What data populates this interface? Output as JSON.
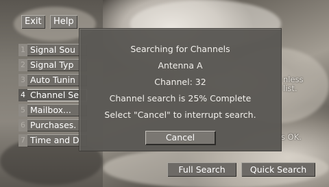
{
  "top_bar": {
    "exit_label": "Exit",
    "help_label": "Help"
  },
  "menu": {
    "items": [
      {
        "num": "1",
        "label": "Signal Sou"
      },
      {
        "num": "2",
        "label": "Signal Typ"
      },
      {
        "num": "3",
        "label": "Auto Tunin"
      },
      {
        "num": "4",
        "label": "Channel Se"
      },
      {
        "num": "5",
        "label": "Mailbox..."
      },
      {
        "num": "6",
        "label": "Purchases."
      },
      {
        "num": "7",
        "label": "Time and D"
      }
    ],
    "active_index": 3
  },
  "background_hints": {
    "line1": "nless",
    "line2": "list.",
    "line3": "s OK."
  },
  "dialog": {
    "title": "Searching for Channels",
    "antenna": "Antenna A",
    "channel": "Channel:  32",
    "progress_text": "Channel search is 25% Complete",
    "progress_percent": 25,
    "instruction": "Select \"Cancel\" to interrupt search.",
    "cancel_label": "Cancel"
  },
  "bottom_buttons": {
    "full_search": "Full Search",
    "quick_search": "Quick Search"
  }
}
